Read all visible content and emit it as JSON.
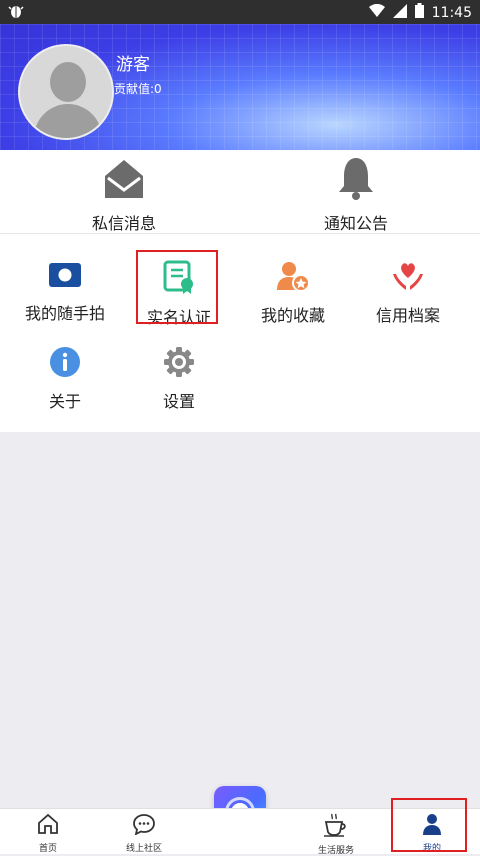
{
  "statusbar": {
    "time": "11:45"
  },
  "profile": {
    "name": "游客",
    "contribution": "贡献值:0"
  },
  "messages": [
    {
      "label": "私信消息",
      "icon": "envelope-icon"
    },
    {
      "label": "通知公告",
      "icon": "bell-icon"
    }
  ],
  "menu": [
    {
      "label": "我的随手拍",
      "icon": "camera-icon",
      "color": "#1a4fa0"
    },
    {
      "label": "实名认证",
      "icon": "certificate-icon",
      "color": "#2dbd8a"
    },
    {
      "label": "我的收藏",
      "icon": "favorite-user-icon",
      "color": "#f08a4b"
    },
    {
      "label": "信用档案",
      "icon": "heart-hands-icon",
      "color": "#e64545"
    },
    {
      "label": "关于",
      "icon": "info-icon",
      "color": "#4a90e2"
    },
    {
      "label": "设置",
      "icon": "gear-icon",
      "color": "#888888"
    }
  ],
  "tabs": [
    {
      "label": "首页",
      "icon": "home-icon"
    },
    {
      "label": "线上社区",
      "icon": "chat-icon"
    },
    {
      "label": "",
      "icon": "center-action-icon"
    },
    {
      "label": "生活服务",
      "icon": "coffee-icon"
    },
    {
      "label": "我的",
      "icon": "person-icon"
    }
  ],
  "colors": {
    "highlight": "#e02020",
    "active_tab": "#1a3f8a"
  }
}
